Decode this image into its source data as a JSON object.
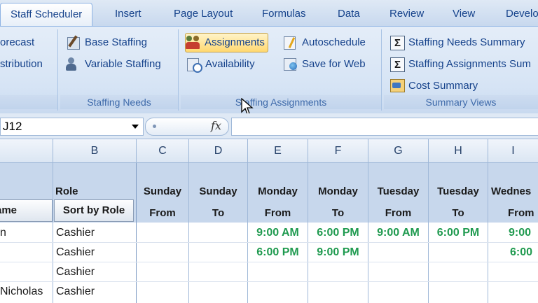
{
  "ribbon_tabs": [
    "Staff Scheduler",
    "Insert",
    "Page Layout",
    "Formulas",
    "Data",
    "Review",
    "View",
    "Develo"
  ],
  "groups": {
    "forecast": {
      "items": [
        "orecast",
        "stribution"
      ]
    },
    "staffing_needs": {
      "label": "Staffing Needs",
      "items": [
        "Base Staffing",
        "Variable Staffing"
      ]
    },
    "staffing_assignments": {
      "label": "Staffing Assignments",
      "items": [
        "Assignments",
        "Availability",
        "Autoschedule",
        "Save for Web"
      ]
    },
    "summary_views": {
      "label": "Summary Views",
      "items": [
        "Staffing Needs Summary",
        "Staffing Assignments Sum",
        "Cost Summary"
      ]
    }
  },
  "formula_bar": {
    "name_box": "J12",
    "fx": "fx",
    "formula": ""
  },
  "columns": [
    "B",
    "C",
    "D",
    "E",
    "F",
    "G",
    "H",
    "I"
  ],
  "row_headers": {
    "role": "Role",
    "name": "ame",
    "sort": "Sort by Role",
    "days": [
      "Sunday",
      "Sunday",
      "Monday",
      "Monday",
      "Tuesday",
      "Tuesday",
      "Wednes"
    ],
    "fromto": [
      "From",
      "To",
      "From",
      "To",
      "From",
      "To",
      "From"
    ]
  },
  "rows": [
    {
      "name": "n",
      "role": "Cashier",
      "times": [
        "",
        "",
        "9:00 AM",
        "6:00 PM",
        "9:00 AM",
        "6:00 PM",
        "9:00"
      ]
    },
    {
      "name": "",
      "role": "Cashier",
      "times": [
        "",
        "",
        "6:00 PM",
        "9:00 PM",
        "",
        "",
        "6:00"
      ]
    },
    {
      "name": "",
      "role": "Cashier",
      "times": [
        "",
        "",
        "",
        "",
        "",
        "",
        ""
      ]
    },
    {
      "name": "Nicholas",
      "role": "Cashier",
      "times": [
        "",
        "",
        "",
        "",
        "",
        "",
        ""
      ]
    }
  ]
}
